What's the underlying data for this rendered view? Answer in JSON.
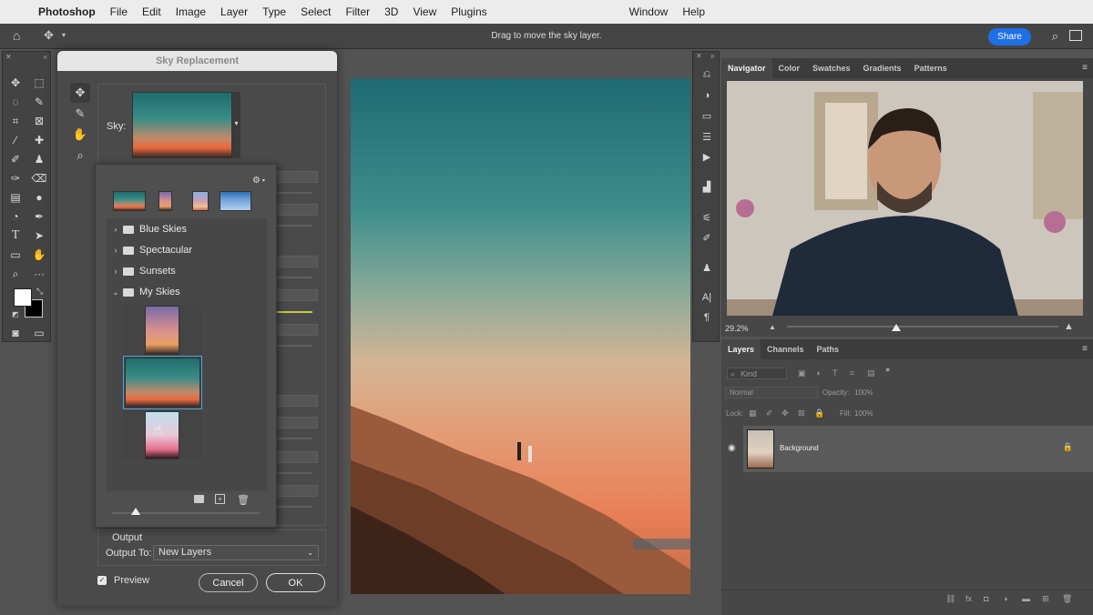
{
  "menubar": {
    "apple": "",
    "app": "Photoshop",
    "items": [
      "File",
      "Edit",
      "Image",
      "Layer",
      "Type",
      "Select",
      "Filter",
      "3D",
      "View",
      "Plugins"
    ],
    "right_items": [
      "Window",
      "Help"
    ]
  },
  "optionsbar": {
    "hint": "Drag to move the sky layer.",
    "share_label": "Share"
  },
  "dialog": {
    "title": "Sky Replacement",
    "sky_label": "Sky:",
    "folders": [
      {
        "label": "Blue Skies",
        "expanded": false
      },
      {
        "label": "Spectacular",
        "expanded": false
      },
      {
        "label": "Sunsets",
        "expanded": false
      },
      {
        "label": "My Skies",
        "expanded": true
      }
    ],
    "output": {
      "section_label": "Output",
      "output_to_label": "Output To:",
      "output_to_value": "New Layers"
    },
    "preview_label": "Preview",
    "preview_checked": true,
    "cancel_label": "Cancel",
    "ok_label": "OK"
  },
  "navigator": {
    "tabs": [
      "Navigator",
      "Color",
      "Swatches",
      "Gradients",
      "Patterns"
    ],
    "active_tab": "Navigator",
    "zoom": "29.2%"
  },
  "layers": {
    "tabs": [
      "Layers",
      "Channels",
      "Paths"
    ],
    "active_tab": "Layers",
    "filter_placeholder": "Kind",
    "blend_mode": "Normal",
    "opacity_label": "Opacity:",
    "opacity_value": "100%",
    "lock_label": "Lock:",
    "fill_label": "Fill:",
    "fill_value": "100%",
    "items": [
      {
        "name": "Background",
        "visible": true,
        "locked": true
      }
    ]
  },
  "colors": {
    "accent": "#1f6fe8",
    "selection": "#4aa3e0"
  }
}
